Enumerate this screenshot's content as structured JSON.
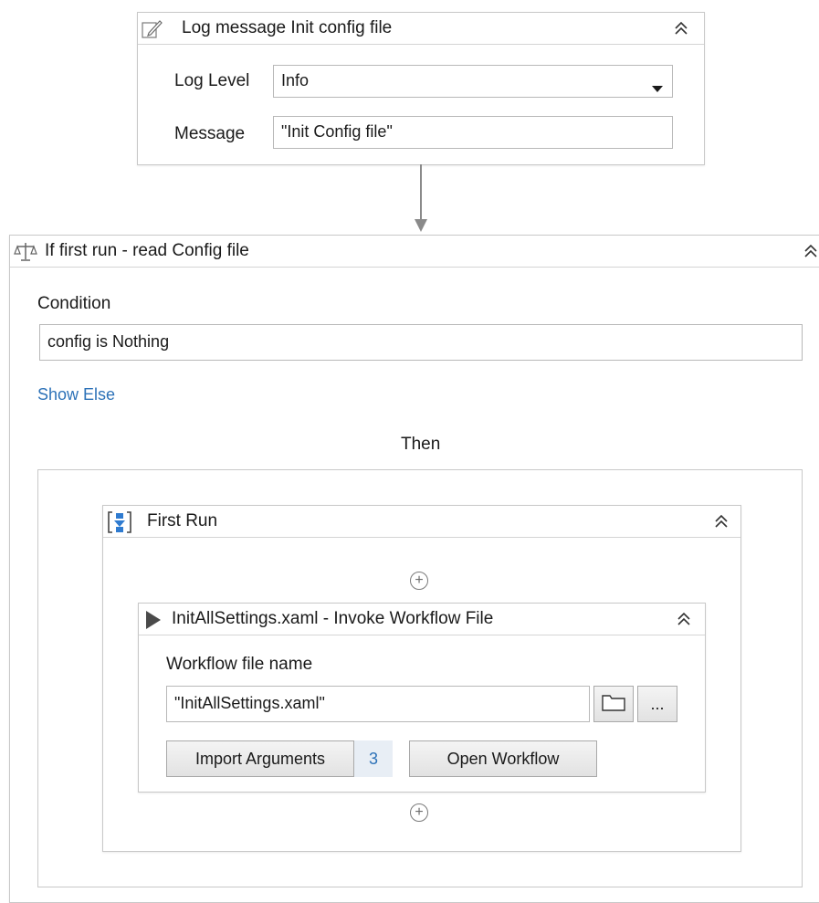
{
  "log_activity": {
    "title": "Log message Init config file",
    "icon": "log-message-icon",
    "log_level_label": "Log Level",
    "log_level_value": "Info",
    "message_label": "Message",
    "message_value": "\"Init Config file\""
  },
  "if_activity": {
    "title": "If first run - read Config file",
    "icon": "if-balance-icon",
    "condition_label": "Condition",
    "condition_value": "config is Nothing",
    "show_else_link": "Show Else",
    "then_label": "Then"
  },
  "sequence": {
    "title": "First Run",
    "icon": "sequence-icon"
  },
  "invoke_activity": {
    "title": "InitAllSettings.xaml - Invoke Workflow File",
    "icon": "play-icon",
    "file_label": "Workflow file name",
    "file_value": "\"InitAllSettings.xaml\"",
    "browse_icon": "folder-icon",
    "ellipsis_label": "...",
    "import_label": "Import Arguments",
    "import_count": "3",
    "open_workflow_label": "Open Workflow"
  },
  "colors": {
    "link": "#2d72b8",
    "border": "#c8c8c8",
    "arrow": "#8a8a8a",
    "count_bg": "#e8eef5"
  }
}
